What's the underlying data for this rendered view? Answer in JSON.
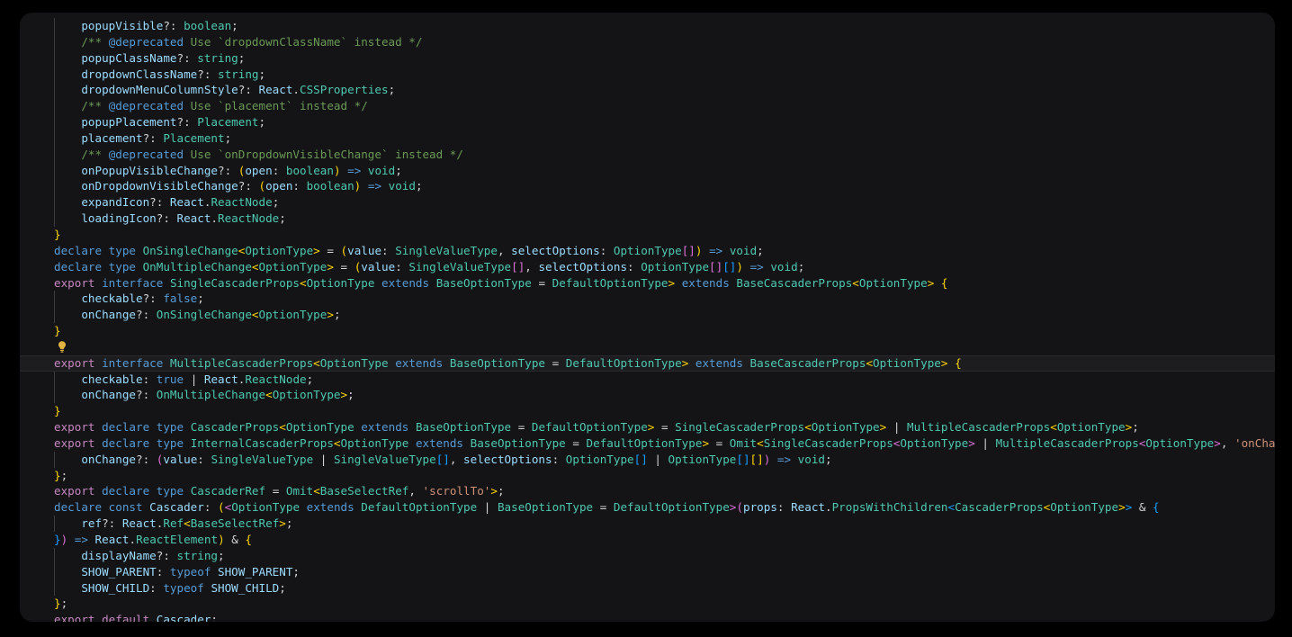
{
  "app": {
    "kind": "code-editor",
    "language": "TypeScript",
    "file_kind": "type-declaration",
    "theme": "dark-plus",
    "panel_background": "#141417",
    "page_background": "#000000",
    "active_line_background": "#1d1d20"
  },
  "colors": {
    "keyword": "#569cd6",
    "keyword_control": "#c586c0",
    "type": "#4ec9b0",
    "property": "#9cdcfe",
    "comment": "#6a9955",
    "string": "#ce9178",
    "punctuation": "#d4d4d4",
    "bracket_1": "#ffd700",
    "bracket_2": "#da70d6",
    "bracket_3": "#179fff",
    "lightbulb": "#e3b341"
  },
  "editor": {
    "lightbulb_icon": "lightbulb-icon",
    "lightbulb_line_index": 21,
    "active_line_index": 22,
    "indent_guides": [
      1,
      2
    ]
  },
  "code": {
    "lines": [
      "    popupVisible?: boolean;",
      "    /** @deprecated Use `dropdownClassName` instead */",
      "    popupClassName?: string;",
      "    dropdownClassName?: string;",
      "    dropdownMenuColumnStyle?: React.CSSProperties;",
      "    /** @deprecated Use `placement` instead */",
      "    popupPlacement?: Placement;",
      "    placement?: Placement;",
      "    /** @deprecated Use `onDropdownVisibleChange` instead */",
      "    onPopupVisibleChange?: (open: boolean) => void;",
      "    onDropdownVisibleChange?: (open: boolean) => void;",
      "    expandIcon?: React.ReactNode;",
      "    loadingIcon?: React.ReactNode;",
      "}",
      "declare type OnSingleChange<OptionType> = (value: SingleValueType, selectOptions: OptionType[]) => void;",
      "declare type OnMultipleChange<OptionType> = (value: SingleValueType[], selectOptions: OptionType[][]) => void;",
      "export interface SingleCascaderProps<OptionType extends BaseOptionType = DefaultOptionType> extends BaseCascaderProps<OptionType> {",
      "    checkable?: false;",
      "    onChange?: OnSingleChange<OptionType>;",
      "}",
      "export interface MultipleCascaderProps<OptionType extends BaseOptionType = DefaultOptionType> extends BaseCascaderProps<OptionType> {",
      "    checkable: true | React.ReactNode;",
      "    onChange?: OnMultipleChange<OptionType>;",
      "}",
      "export declare type CascaderProps<OptionType extends BaseOptionType = DefaultOptionType> = SingleCascaderProps<OptionType> | MultipleCascaderProps<OptionType>;",
      "export declare type InternalCascaderProps<OptionType extends BaseOptionType = DefaultOptionType> = Omit<SingleCascaderProps<OptionType> | MultipleCascaderProps<OptionType>, 'onChange'> & {",
      "    onChange?: (value: SingleValueType | SingleValueType[], selectOptions: OptionType[] | OptionType[][]) => void;",
      "};",
      "export declare type CascaderRef = Omit<BaseSelectRef, 'scrollTo'>;",
      "declare const Cascader: (<OptionType extends DefaultOptionType | BaseOptionType = DefaultOptionType>(props: React.PropsWithChildren<CascaderProps<OptionType>> & {",
      "    ref?: React.Ref<BaseSelectRef>;",
      "}) => React.ReactElement) & {",
      "    displayName?: string;",
      "    SHOW_PARENT: typeof SHOW_PARENT;",
      "    SHOW_CHILD: typeof SHOW_CHILD;",
      "};",
      "export default Cascader;"
    ],
    "identifiers": [
      "popupVisible",
      "boolean",
      "popupClassName",
      "string",
      "dropdownClassName",
      "dropdownMenuColumnStyle",
      "React.CSSProperties",
      "popupPlacement",
      "Placement",
      "placement",
      "onPopupVisibleChange",
      "onDropdownVisibleChange",
      "open",
      "void",
      "expandIcon",
      "loadingIcon",
      "React.ReactNode",
      "OnSingleChange",
      "OptionType",
      "value",
      "SingleValueType",
      "selectOptions",
      "OnMultipleChange",
      "SingleCascaderProps",
      "BaseOptionType",
      "DefaultOptionType",
      "BaseCascaderProps",
      "checkable",
      "false",
      "true",
      "onChange",
      "MultipleCascaderProps",
      "OnMultipleChange",
      "CascaderProps",
      "InternalCascaderProps",
      "Omit",
      "CascaderRef",
      "BaseSelectRef",
      "Cascader",
      "props",
      "React.PropsWithChildren",
      "ref",
      "React.Ref",
      "React.ReactElement",
      "displayName",
      "SHOW_PARENT",
      "SHOW_CHILD"
    ],
    "strings": [
      "'onChange'",
      "'scrollTo'"
    ],
    "comments": [
      "/** @deprecated Use `dropdownClassName` instead */",
      "/** @deprecated Use `placement` instead */",
      "/** @deprecated Use `onDropdownVisibleChange` instead */"
    ]
  }
}
